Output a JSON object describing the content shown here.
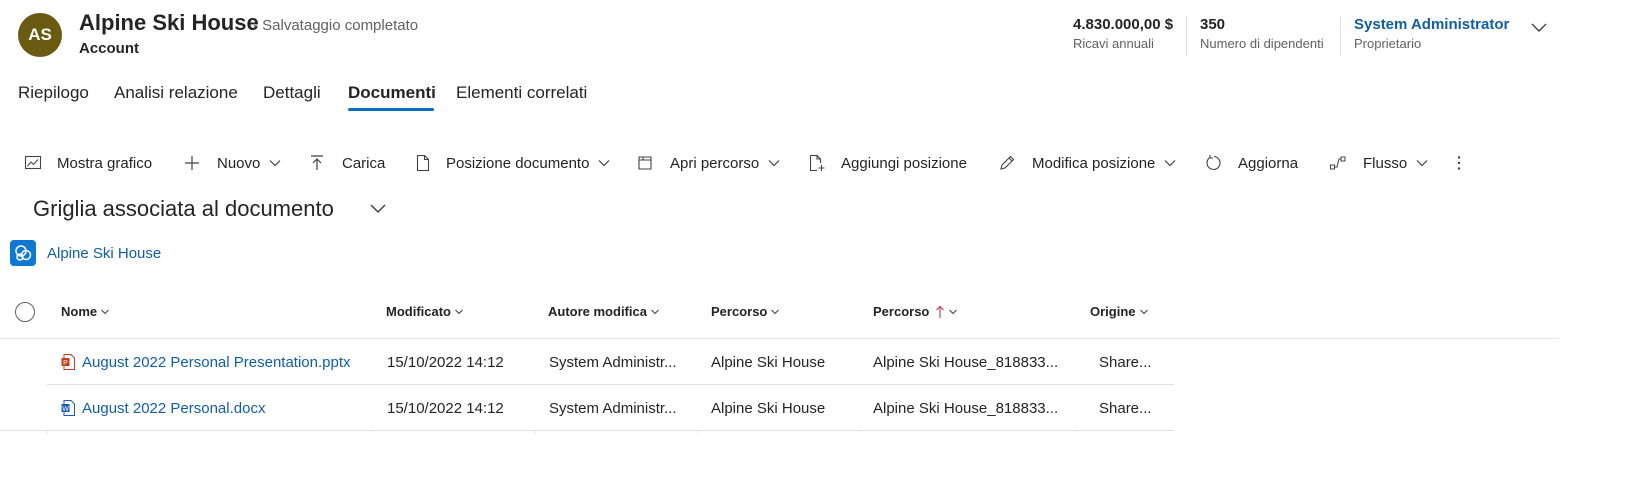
{
  "header": {
    "avatar_initials": "AS",
    "title": "Alpine Ski House",
    "save_status": "- Salvataggio completato",
    "entity": "Account",
    "kpis": [
      {
        "value": "4.830.000,00 $",
        "label": "Ricavi annuali"
      },
      {
        "value": "350",
        "label": "Numero di dipendenti"
      },
      {
        "value": "System Administrator",
        "label": "Proprietario"
      }
    ],
    "colors": {
      "avatar": "#6b5a12",
      "link": "#115ea3",
      "accent": "#0f6cbd"
    }
  },
  "tabs": [
    {
      "label": "Riepilogo",
      "active": false
    },
    {
      "label": "Analisi relazione",
      "active": false
    },
    {
      "label": "Dettagli",
      "active": false
    },
    {
      "label": "Documenti",
      "active": true
    },
    {
      "label": "Elementi correlati",
      "active": false
    }
  ],
  "commands": [
    {
      "label": "Mostra grafico",
      "icon": "chart-icon",
      "dropdown": false
    },
    {
      "label": "Nuovo",
      "icon": "plus-icon",
      "dropdown": true
    },
    {
      "label": "Carica",
      "icon": "upload-icon",
      "dropdown": false
    },
    {
      "label": "Posizione documento",
      "icon": "document-location-icon",
      "dropdown": true
    },
    {
      "label": "Apri percorso",
      "icon": "open-folder-icon",
      "dropdown": true
    },
    {
      "label": "Aggiungi posizione",
      "icon": "add-document-icon",
      "dropdown": false
    },
    {
      "label": "Modifica posizione",
      "icon": "pencil-icon",
      "dropdown": true
    },
    {
      "label": "Aggiorna",
      "icon": "refresh-icon",
      "dropdown": false
    },
    {
      "label": "Flusso",
      "icon": "flow-icon",
      "dropdown": true
    },
    {
      "label": "",
      "icon": "more-icon",
      "dropdown": false
    }
  ],
  "section": {
    "title": "Griglia associata al documento",
    "sharepoint_link": "Alpine Ski House"
  },
  "grid": {
    "columns": [
      "Nome",
      "Modificato",
      "Autore modifica",
      "Percorso",
      "Percorso",
      "Origine"
    ],
    "sorted_column_index": 4,
    "sort_direction": "ascending",
    "rows": [
      {
        "type": "pptx",
        "name": "August 2022 Personal Presentation.pptx",
        "modified": "15/10/2022 14:12",
        "author": "System Administr...",
        "location": "Alpine Ski House",
        "path": "Alpine Ski House_818833...",
        "source": "Share..."
      },
      {
        "type": "docx",
        "name": "August 2022 Personal.docx",
        "modified": "15/10/2022 14:12",
        "author": "System Administr...",
        "location": "Alpine Ski House",
        "path": "Alpine Ski House_818833...",
        "source": "Share..."
      }
    ]
  }
}
